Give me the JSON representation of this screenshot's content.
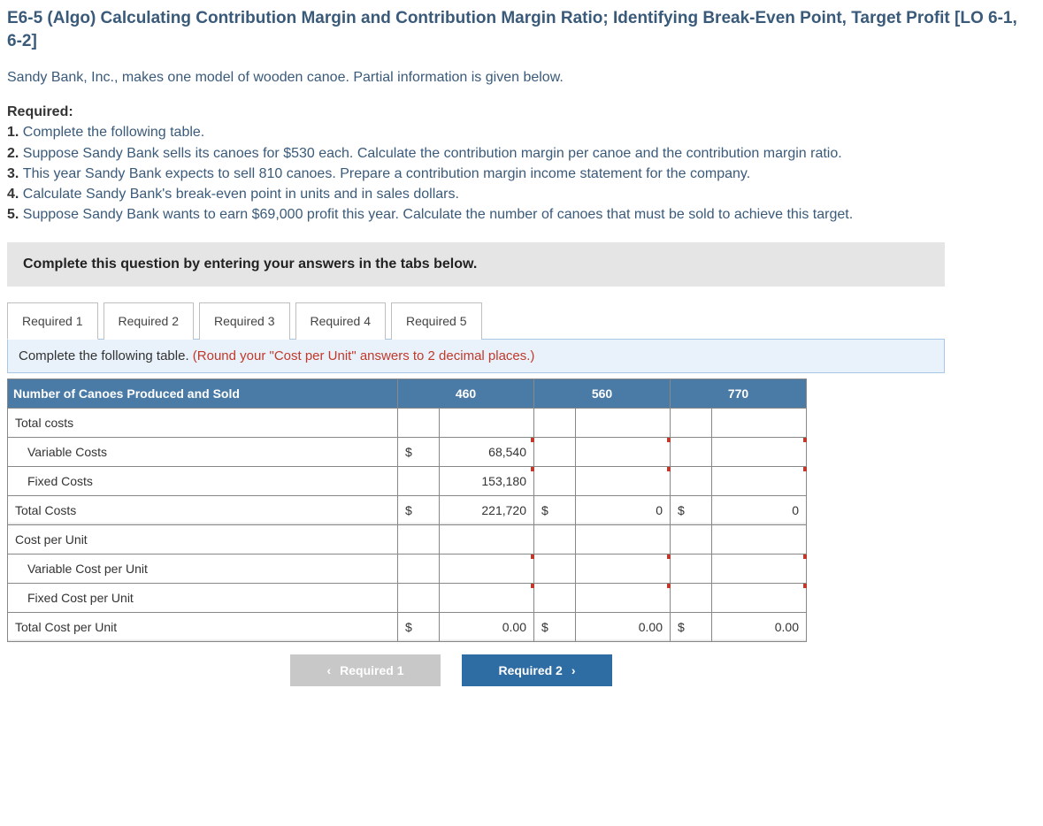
{
  "title": "E6-5 (Algo) Calculating Contribution Margin and Contribution Margin Ratio; Identifying Break-Even Point, Target Profit [LO 6-1, 6-2]",
  "intro": "Sandy Bank, Inc., makes one model of wooden canoe. Partial information is given below.",
  "requiredHeader": "Required:",
  "requirements": {
    "r1": "Complete the following table.",
    "r2": "Suppose Sandy Bank sells its canoes for $530 each. Calculate the contribution margin per canoe and the contribution margin ratio.",
    "r3": "This year Sandy Bank expects to sell 810 canoes. Prepare a contribution margin income statement for the company.",
    "r4": "Calculate Sandy Bank's break-even point in units and in sales dollars.",
    "r5": "Suppose Sandy Bank wants to earn $69,000 profit this year. Calculate the number of canoes that must be sold to achieve this target."
  },
  "instruction": "Complete this question by entering your answers in the tabs below.",
  "tabs": {
    "t1": "Required 1",
    "t2": "Required 2",
    "t3": "Required 3",
    "t4": "Required 4",
    "t5": "Required 5"
  },
  "tabPrompt": {
    "black": "Complete the following table. ",
    "red": "(Round your \"Cost per Unit\" answers to 2 decimal places.)"
  },
  "table": {
    "headLabel": "Number of Canoes Produced and Sold",
    "col1": "460",
    "col2": "560",
    "col3": "770",
    "rows": {
      "totalCostsLabel": "Total costs",
      "variableCostsLabel": "Variable Costs",
      "fixedCostsLabel": "Fixed Costs",
      "totalCostsSumLabel": "Total Costs",
      "costPerUnitLabel": "Cost per Unit",
      "varCostPerUnitLabel": "Variable Cost per Unit",
      "fixedCostPerUnitLabel": "Fixed Cost per Unit",
      "totalCostPerUnitLabel": "Total Cost per Unit"
    },
    "values": {
      "varCosts_460_sym": "$",
      "varCosts_460": "68,540",
      "fixedCosts_460": "153,180",
      "totalCosts_460_sym": "$",
      "totalCosts_460": "221,720",
      "totalCosts_560_sym": "$",
      "totalCosts_560": "0",
      "totalCosts_770_sym": "$",
      "totalCosts_770": "0",
      "totalCPU_460_sym": "$",
      "totalCPU_460": "0.00",
      "totalCPU_560_sym": "$",
      "totalCPU_560": "0.00",
      "totalCPU_770_sym": "$",
      "totalCPU_770": "0.00"
    }
  },
  "nav": {
    "prev": "Required 1",
    "next": "Required 2"
  }
}
